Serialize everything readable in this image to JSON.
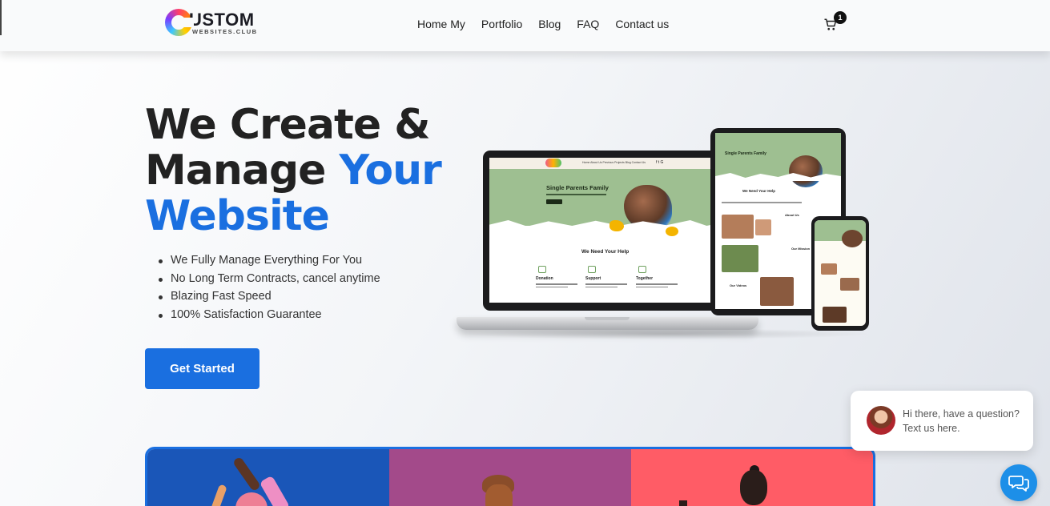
{
  "header": {
    "logo": {
      "main": "USTOM",
      "sub": "WEBSITES.CLUB"
    },
    "nav": [
      "Home My",
      "Portfolio",
      "Blog",
      "FAQ",
      "Contact us"
    ],
    "cart_count": "1"
  },
  "hero": {
    "title_line1": "We Create &",
    "title_line2_a": "Manage ",
    "title_line2_b": "Your",
    "title_line3": "Website",
    "features": [
      "We Fully Manage Everything For You",
      "No Long Term Contracts, cancel anytime",
      "Blazing Fast Speed",
      "100% Satisfaction Guarantee"
    ],
    "cta_label": "Get Started"
  },
  "mockup": {
    "nav_links": "Home   About Us   Previous Projects   Blog   Contact Us",
    "social": "f  t  G",
    "hero_title": "Single Parents Family",
    "section_title": "We Need Your Help",
    "columns": [
      "Donation",
      "Support",
      "Together"
    ],
    "tablet_about": "About Us",
    "tablet_mission": "Our Mission",
    "tablet_videos": "Our Videos"
  },
  "chat": {
    "message": "Hi there, have a question? Text us here."
  },
  "colors": {
    "accent": "#1a6fe0",
    "panel1": "#1a56b8",
    "panel2": "#a34a8a",
    "panel3": "#ff5c66",
    "chat_button": "#1d8fe8"
  },
  "icons": [
    "cart-icon",
    "chat-icon"
  ]
}
